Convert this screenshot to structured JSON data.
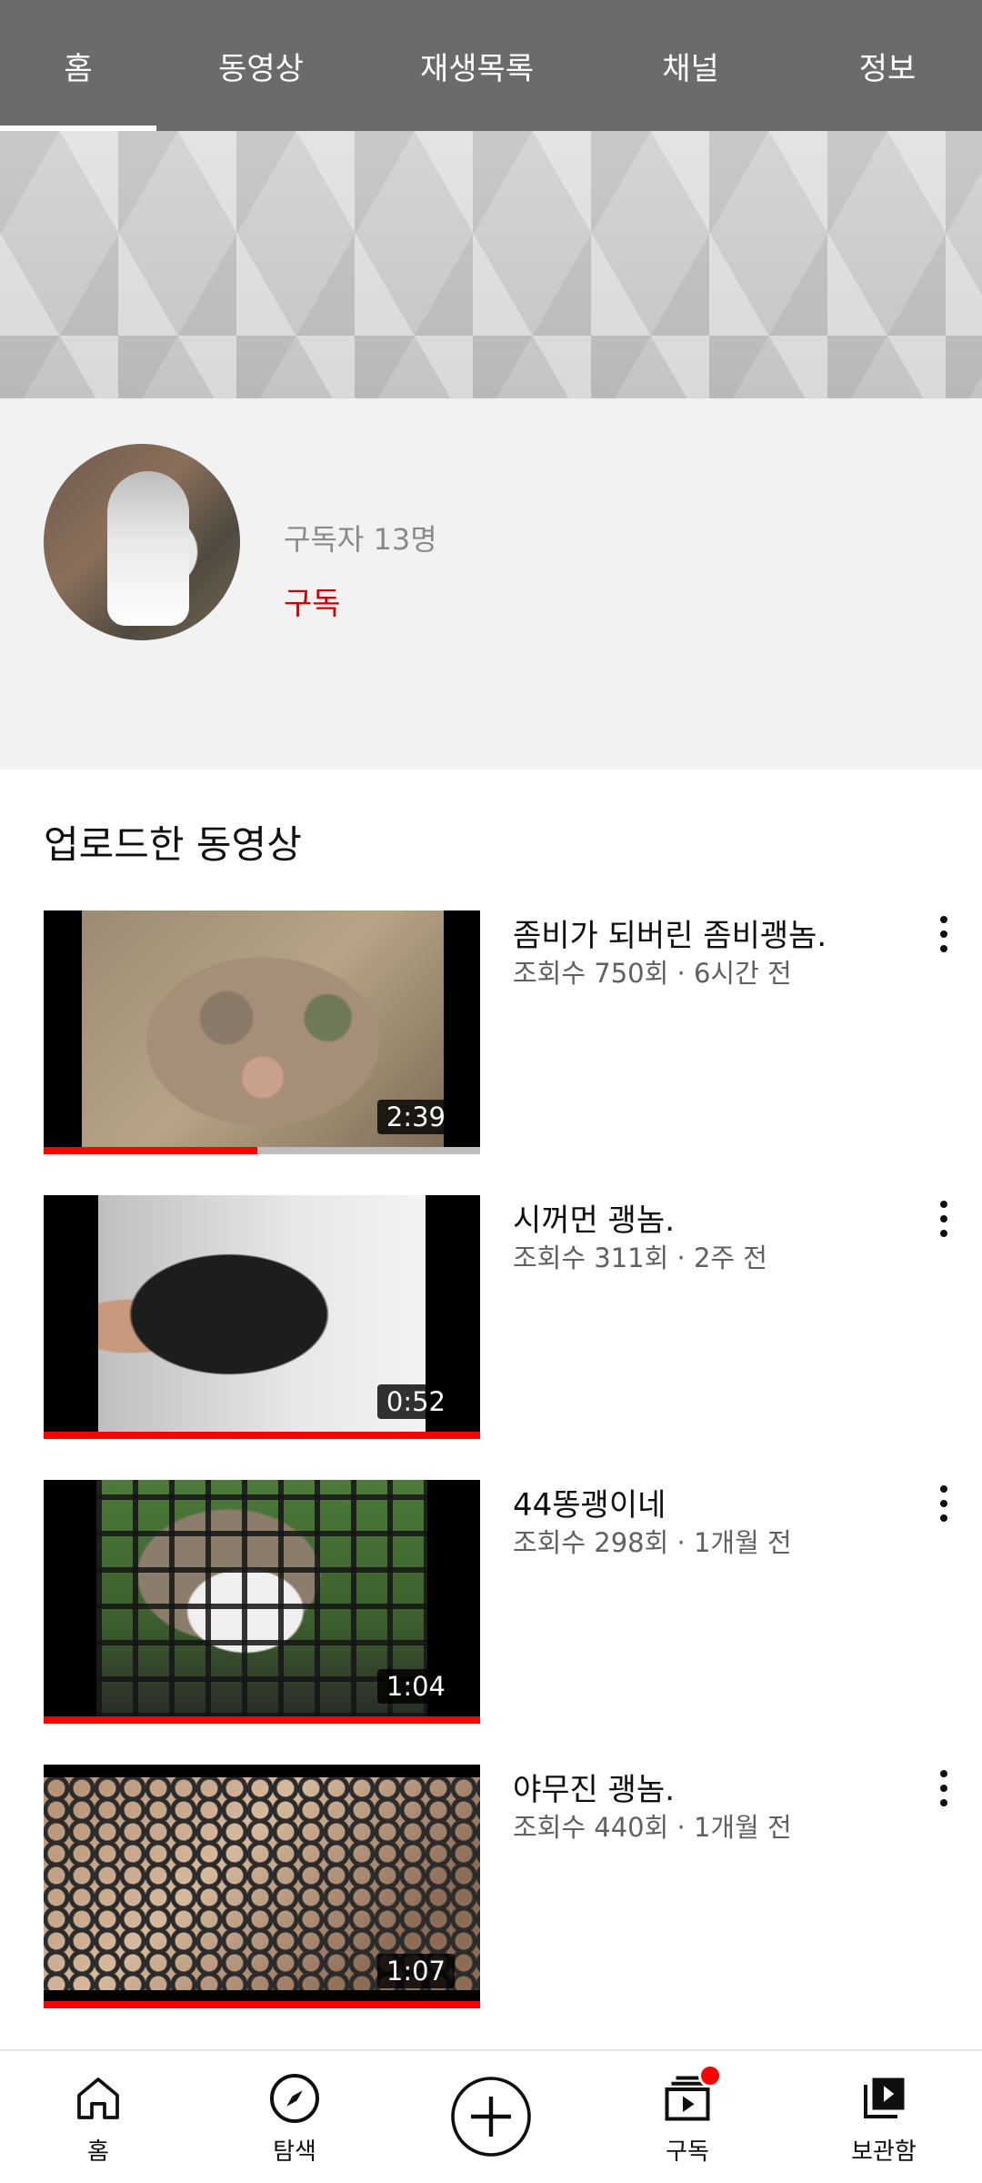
{
  "tabs": [
    {
      "label": "홈",
      "active": true
    },
    {
      "label": "동영상"
    },
    {
      "label": "재생목록"
    },
    {
      "label": "채널"
    },
    {
      "label": "정보"
    }
  ],
  "channel": {
    "subscribers": "구독자 13명",
    "subscribe_label": "구독"
  },
  "section": {
    "title": "업로드한 동영상"
  },
  "videos": [
    {
      "title": "좀비가 되버린 좀비괭놈.",
      "meta": "조회수 750회 · 6시간 전",
      "duration": "2:39",
      "watched_fraction": 0.49
    },
    {
      "title": "시꺼먼 괭놈.",
      "meta": "조회수 311회 · 2주 전",
      "duration": "0:52",
      "watched_fraction": 1.0
    },
    {
      "title": "44똥괭이네",
      "meta": "조회수 298회 · 1개월 전",
      "duration": "1:04",
      "watched_fraction": 1.0
    },
    {
      "title": "야무진 괭놈.",
      "meta": "조회수 440회 · 1개월 전",
      "duration": "1:07",
      "watched_fraction": 1.0
    }
  ],
  "bottom_nav": [
    {
      "label": "홈",
      "icon": "home-icon"
    },
    {
      "label": "탐색",
      "icon": "compass-icon"
    },
    {
      "label": "",
      "icon": "add-circle-icon"
    },
    {
      "label": "구독",
      "icon": "subscriptions-icon",
      "badge": true
    },
    {
      "label": "보관함",
      "icon": "library-icon"
    }
  ],
  "colors": {
    "accent": "#ff0000",
    "subscribe": "#cc0000",
    "tabbar": "#6b6b6b"
  }
}
